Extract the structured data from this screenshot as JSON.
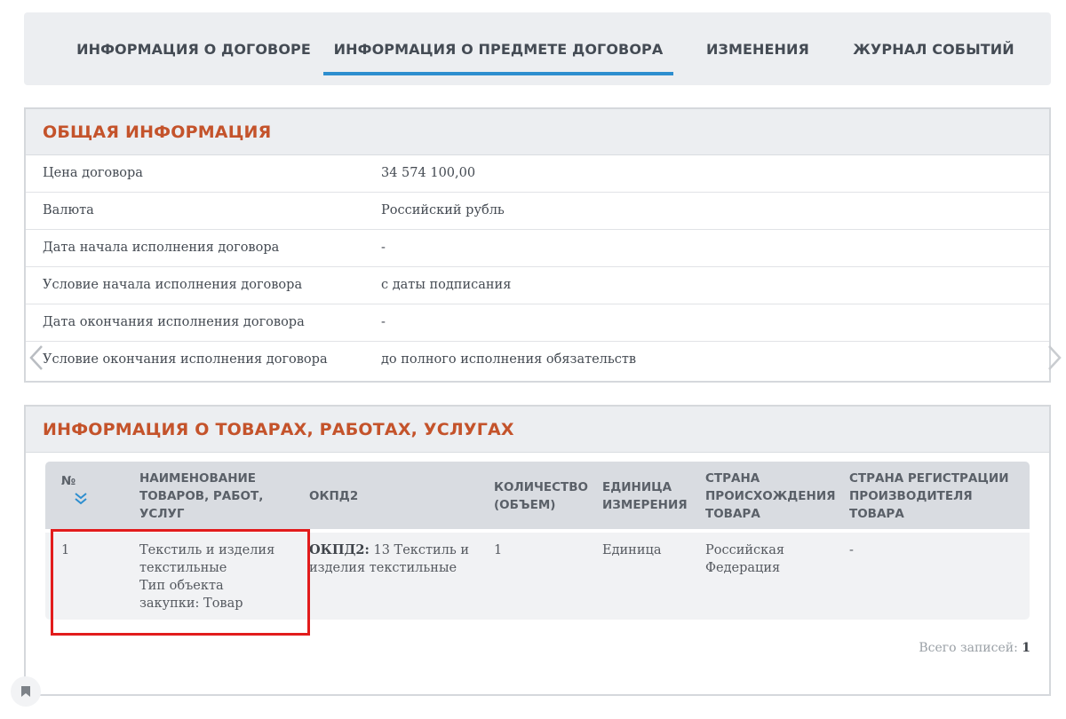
{
  "tabs": [
    {
      "label": "ИНФОРМАЦИЯ О ДОГОВОРЕ",
      "active": false
    },
    {
      "label": "ИНФОРМАЦИЯ О ПРЕДМЕТЕ ДОГОВОРА",
      "active": true
    },
    {
      "label": "ИЗМЕНЕНИЯ",
      "active": false
    },
    {
      "label": "ЖУРНАЛ СОБЫТИЙ",
      "active": false
    }
  ],
  "general": {
    "title": "ОБЩАЯ ИНФОРМАЦИЯ",
    "rows": [
      {
        "label": "Цена договора",
        "value": "34 574 100,00"
      },
      {
        "label": "Валюта",
        "value": "Российский рубль"
      },
      {
        "label": "Дата начала исполнения договора",
        "value": "-"
      },
      {
        "label": "Условие начала исполнения договора",
        "value": "с даты подписания"
      },
      {
        "label": "Дата окончания исполнения договора",
        "value": "-"
      },
      {
        "label": "Условие окончания исполнения договора",
        "value": "до полного исполнения обязательств"
      }
    ]
  },
  "goods": {
    "title": "ИНФОРМАЦИЯ О ТОВАРАХ, РАБОТАХ, УСЛУГАХ",
    "columns": {
      "num": "№",
      "name": "НАИМЕНОВАНИЕ ТОВАРОВ, РАБОТ, УСЛУГ",
      "okpd": "ОКПД2",
      "qty": "КОЛИЧЕСТВО (ОБЪЕМ)",
      "unit": "ЕДИНИЦА ИЗМЕРЕНИЯ",
      "origin": "СТРАНА ПРОИСХОЖДЕНИЯ ТОВАРА",
      "reg": "СТРАНА РЕГИСТРАЦИИ ПРОИЗВОДИТЕЛЯ ТОВАРА"
    },
    "rows": [
      {
        "num": "1",
        "name": "Текстиль и изделия текстильные",
        "type_line": "Тип объекта закупки: Товар",
        "okpd_label": "ОКПД2:",
        "okpd_value": "13 Текстиль и изделия текстильные",
        "qty": "1",
        "unit": "Единица",
        "origin": "Российская Федерация",
        "reg": "-"
      }
    ],
    "total_label": "Всего записей:",
    "total_value": "1"
  },
  "icons": {
    "sort": "chevron-double-down-icon",
    "left": "chevron-left-icon",
    "right": "chevron-right-icon",
    "bookmark": "bookmark-icon"
  },
  "colors": {
    "accent": "#2d8ecf",
    "section_title": "#c4532b",
    "highlight": "#e21c1c"
  }
}
